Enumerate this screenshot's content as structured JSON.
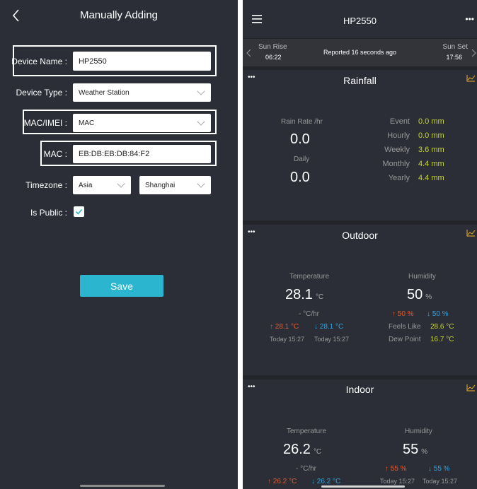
{
  "left": {
    "title": "Manually Adding",
    "fields": {
      "device_name_label": "Device Name :",
      "device_name_value": "HP2550",
      "device_type_label": "Device Type :",
      "device_type_value": "Weather Station",
      "mac_imei_label": "MAC/IMEI :",
      "mac_imei_value": "MAC",
      "mac_label": "MAC :",
      "mac_value": "EB:DB:EB:DB:84:F2",
      "timezone_label": "Timezone :",
      "timezone_region": "Asia",
      "timezone_city": "Shanghai",
      "is_public_label": "Is Public :",
      "is_public_checked": true
    },
    "save_label": "Save"
  },
  "right": {
    "title": "HP2550",
    "sunbar": {
      "sunrise_label": "Sun Rise",
      "sunrise_time": "06:22",
      "reported": "Reported 16 seconds ago",
      "sunset_label": "Sun Set",
      "sunset_time": "17:56"
    },
    "rainfall": {
      "title": "Rainfall",
      "rate_label": "Rain Rate /hr",
      "rate_value": "0.0",
      "daily_label": "Daily",
      "daily_value": "0.0",
      "rows": [
        {
          "label": "Event",
          "value": "0.0 mm"
        },
        {
          "label": "Hourly",
          "value": "0.0 mm"
        },
        {
          "label": "Weekly",
          "value": "3.6 mm"
        },
        {
          "label": "Monthly",
          "value": "4.4 mm"
        },
        {
          "label": "Yearly",
          "value": "4.4 mm"
        }
      ]
    },
    "outdoor": {
      "title": "Outdoor",
      "temp_label": "Temperature",
      "temp_value": "28.1",
      "temp_unit": "°C",
      "temp_rate": "- °C/hr",
      "temp_high": "↑ 28.1 °C",
      "temp_low": "↓ 28.1 °C",
      "temp_high_time": "Today 15:27",
      "temp_low_time": "Today 15:27",
      "hum_label": "Humidity",
      "hum_value": "50",
      "hum_unit": "%",
      "hum_high": "↑ 50 %",
      "hum_low": "↓ 50 %",
      "feels_label": "Feels Like",
      "feels_value": "28.6 °C",
      "dew_label": "Dew Point",
      "dew_value": "16.7 °C"
    },
    "indoor": {
      "title": "Indoor",
      "temp_label": "Temperature",
      "temp_value": "26.2",
      "temp_unit": "°C",
      "temp_rate": "- °C/hr",
      "temp_high": "↑ 26.2 °C",
      "temp_low": "↓ 26.2 °C",
      "hum_label": "Humidity",
      "hum_value": "55",
      "hum_unit": "%",
      "hum_high": "↑ 55 %",
      "hum_low": "↓ 55 %",
      "hum_high_time": "Today 15:27",
      "hum_low_time": "Today 15:27"
    }
  },
  "colors": {
    "accent": "#2bb5cf",
    "value_green": "#c6d52e",
    "high_red": "#e45c2e",
    "low_blue": "#2ea6e4",
    "chart_icon": "#f0b429"
  },
  "icons": [
    "back-icon",
    "chevron-down-icon",
    "check-icon",
    "hamburger-menu-icon",
    "more-icon",
    "chevron-left-icon",
    "chevron-right-icon",
    "line-chart-icon"
  ]
}
